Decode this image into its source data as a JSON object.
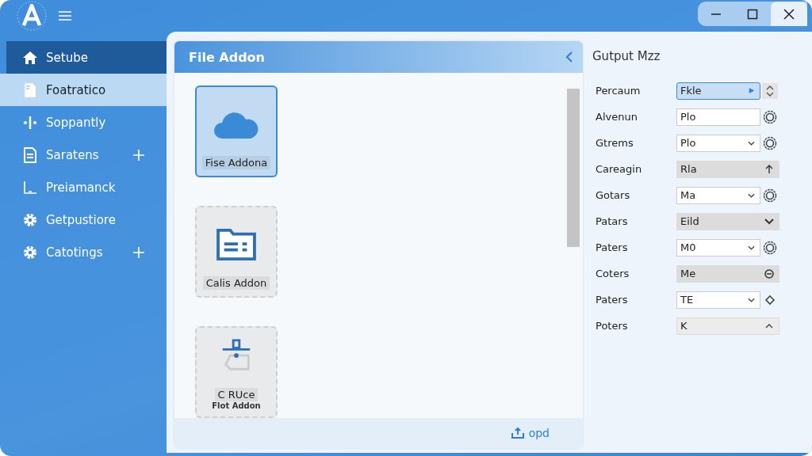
{
  "sidebar": {
    "items": [
      {
        "label": "Setube",
        "selected": true,
        "hovered": false,
        "expandable": false,
        "kind": "home"
      },
      {
        "label": "Foatratico",
        "selected": false,
        "hovered": true,
        "expandable": false,
        "kind": "doc"
      },
      {
        "label": "Soppantly",
        "selected": false,
        "hovered": false,
        "expandable": false,
        "kind": "wave"
      },
      {
        "label": "Saratens",
        "selected": false,
        "hovered": false,
        "expandable": true,
        "kind": "list"
      },
      {
        "label": "Preiamanck",
        "selected": false,
        "hovered": false,
        "expandable": false,
        "kind": "chart"
      },
      {
        "label": "Getpustiore",
        "selected": false,
        "hovered": false,
        "expandable": false,
        "kind": "gear"
      },
      {
        "label": "Catotings",
        "selected": false,
        "hovered": false,
        "expandable": true,
        "kind": "gear"
      }
    ]
  },
  "addon_panel": {
    "title": "File Addon",
    "tiles": [
      {
        "label": "Fise Addona",
        "selected": true,
        "kind": "cloud"
      },
      {
        "label": "Calis Addon",
        "selected": false,
        "kind": "folder"
      },
      {
        "label": "C RUce",
        "sublabel": "Flot Addon",
        "selected": false,
        "kind": "plug"
      }
    ],
    "footer_action": "opd"
  },
  "properties": {
    "title": "Gutput Mzz",
    "rows": [
      {
        "label": "Percaum",
        "value": "Fkle",
        "kind": "spinner"
      },
      {
        "label": "Alvenun",
        "value": "Plo",
        "kind": "gear-field"
      },
      {
        "label": "Gtrems",
        "value": "Plo",
        "kind": "gear-select"
      },
      {
        "label": "Careagin",
        "value": "Rla",
        "kind": "filled-up"
      },
      {
        "label": "Gotars",
        "value": "Ma",
        "kind": "gear-select"
      },
      {
        "label": "Patars",
        "value": "Eild",
        "kind": "filled-chevron"
      },
      {
        "label": "Paters",
        "value": "M0",
        "kind": "gear-select"
      },
      {
        "label": "Coters",
        "value": "Me",
        "kind": "filled-circle"
      },
      {
        "label": "Paters",
        "value": "TE",
        "kind": "diamond-select"
      },
      {
        "label": "Poters",
        "value": "K",
        "kind": "filled-caret"
      }
    ]
  }
}
